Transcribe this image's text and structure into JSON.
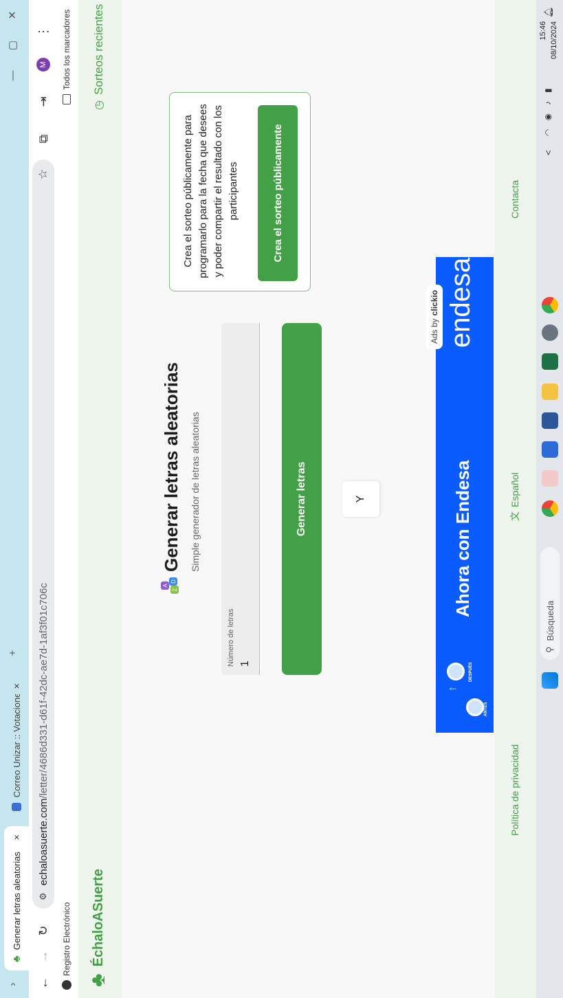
{
  "browser": {
    "tabs": [
      {
        "title": "Generar letras aleatorias",
        "close": "×"
      },
      {
        "title": "Correo Unizar :: Votaciones del",
        "close": "×"
      }
    ],
    "new_tab": "+",
    "url_host": "echaloasuerte.com",
    "url_path": "/letter/4686d331-d61f-42dc-ae7d-1af3f01c706c",
    "bookmark_left": "Registro Electrónico",
    "bookmark_right": "Todos los marcadores",
    "profile_letter": "M"
  },
  "site": {
    "brand": "ÉchaloASuerte",
    "recent": "Sorteos recientes",
    "title": "Generar letras aleatorias",
    "subtitle": "Simple generador de letras aleatorias",
    "logo_letters": [
      "A",
      "D",
      "Z"
    ],
    "field_label": "Número de letras",
    "field_value": "1",
    "generate_button": "Generar letras",
    "result_letter": "Y",
    "public_text": "Crea el sorteo públicamente para programarlo para la fecha que desees y poder compartir el resultado con los participantes",
    "public_button": "Crea el sorteo públicamente",
    "ad_tag_prefix": "Ads by",
    "ad_tag_brand": "clickio",
    "ad_headline": "Ahora con Endesa",
    "ad_brand": "endesa",
    "ad_before": "ANTES",
    "ad_after": "DESPUÉS",
    "footer_privacy": "Política de privacidad",
    "footer_language": "Español",
    "footer_contact": "Contacta"
  },
  "taskbar": {
    "search": "Búsqueda",
    "time": "15:46",
    "date": "08/10/2024",
    "overflow": "<"
  },
  "colors": {
    "green": "#43a047",
    "ad_blue": "#0a5cff",
    "tab_strip": "#c5e6ef"
  }
}
